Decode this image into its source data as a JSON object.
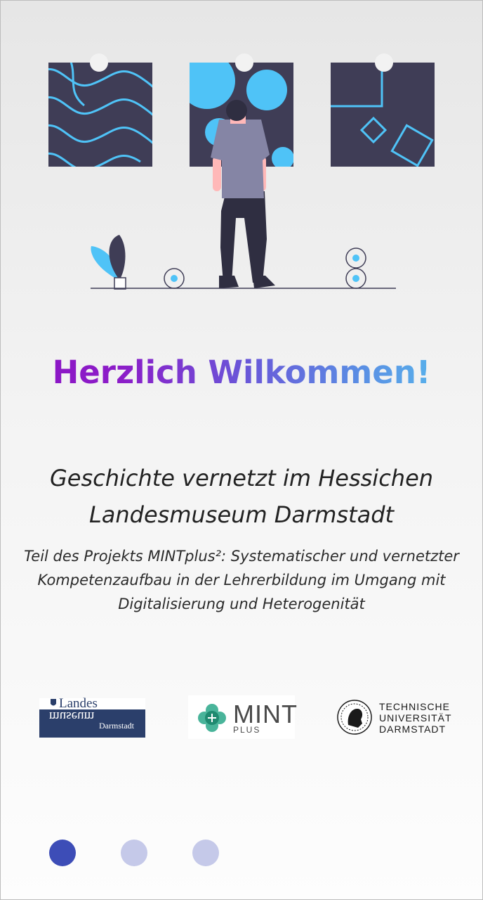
{
  "welcome": {
    "title": "Herzlich Wilkommen!"
  },
  "intro": {
    "subtitle": "Geschichte vernetzt im Hessichen Landesmuseum Darmstadt",
    "description": "Teil des Projekts MINTplus²: Systematischer und vernetzter Kompetenzaufbau in der Lehrerbildung im Umgang mit Digitalisierung und Heterogenität"
  },
  "logos": {
    "landesmuseum": {
      "landes": "Landes",
      "museum": "museum",
      "city": "Darmstadt"
    },
    "mintplus": {
      "mint": "MINT",
      "plus": "PLUS"
    },
    "tu": {
      "line1": "TECHNISCHE",
      "line2": "UNIVERSITÄT",
      "line3": "DARMSTADT"
    }
  },
  "pager": {
    "pages": 3,
    "current_index": 0,
    "active_color": "#3d4db7",
    "inactive_color": "#c5c9e9"
  },
  "colors": {
    "accent_blue": "#4fc3f7",
    "dark_navy": "#3f3d56"
  }
}
